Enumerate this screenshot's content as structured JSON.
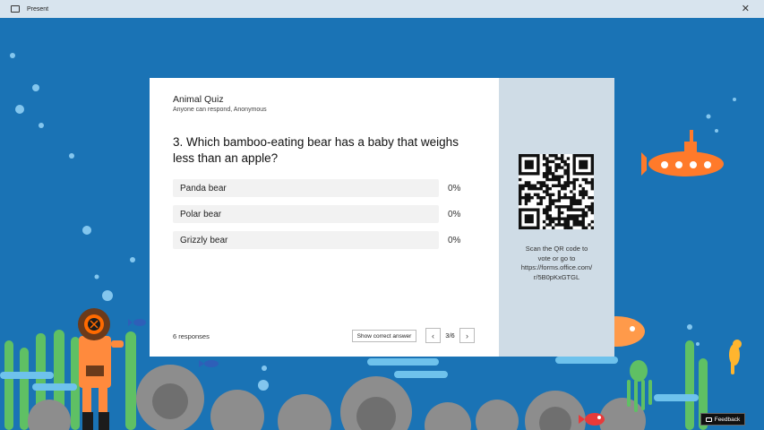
{
  "window": {
    "title": "Present",
    "close_glyph": "✕"
  },
  "quiz": {
    "title": "Animal Quiz",
    "subtitle": "Anyone can respond, Anonymous",
    "question": "3. Which bamboo-eating bear has a baby that weighs less than an apple?",
    "options": [
      {
        "label": "Panda bear",
        "percent": "0%"
      },
      {
        "label": "Polar bear",
        "percent": "0%"
      },
      {
        "label": "Grizzly bear",
        "percent": "0%"
      }
    ],
    "responses": "6 responses",
    "show_answer_label": "Show correct answer",
    "page_indicator": "3/6",
    "prev_glyph": "‹",
    "next_glyph": "›"
  },
  "qr": {
    "scan_text_lines": [
      "Scan the QR code to",
      "vote or go to",
      "https://forms.office.com/",
      "r/5B0pKxGTGL"
    ]
  },
  "feedback": {
    "label": "Feedback"
  },
  "colors": {
    "ocean": "#1a73b5",
    "titlebar": "#d8e4ee",
    "panel": "#cfdce6"
  }
}
